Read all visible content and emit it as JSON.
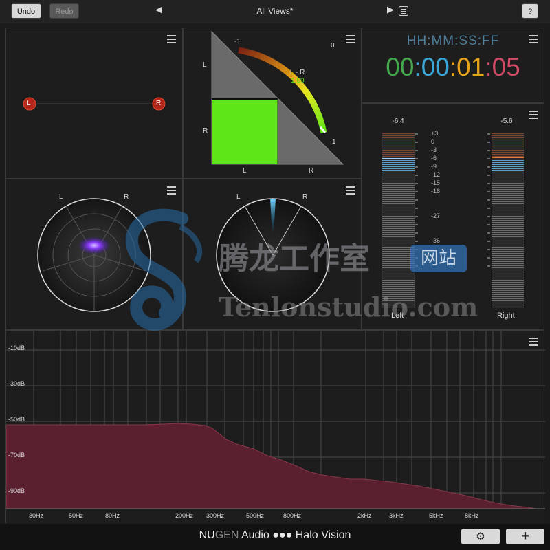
{
  "toolbar": {
    "undo": "Undo",
    "redo": "Redo",
    "prev_arrow": "◀",
    "view_name": "All Views*",
    "next_arrow": "▶",
    "help": "?"
  },
  "panels": {
    "stereo_position": {
      "left_label": "L",
      "right_label": "R"
    },
    "correlation": {
      "scale_minus1": "-1",
      "scale_0": "0",
      "scale_1": "1",
      "side_L_top": "L",
      "side_R_mid": "R",
      "bottom_L": "L",
      "bottom_R": "R",
      "readout_label": "L - R",
      "readout_value": "1.00",
      "correlation_value": 1.0
    },
    "timecode": {
      "format": "HH:MM:SS:FF",
      "hh": "00",
      "mm": "00",
      "ss": "01",
      "ff": "05",
      "sep": ":",
      "colors": {
        "hh": "#43a84b",
        "mm": "#3aa7d8",
        "ss": "#e6a21b",
        "ff": "#d04a66"
      }
    },
    "levels": {
      "left_peak": "-6.4",
      "right_peak": "-5.6",
      "left_label": "Left",
      "right_label": "Right",
      "scale": [
        "+3",
        "0",
        "-3",
        "-6",
        "-9",
        "-12",
        "-15",
        "-18",
        "-27",
        "-36"
      ]
    },
    "surround_left": {
      "left_label": "L",
      "right_label": "R"
    },
    "surround_right": {
      "left_label": "L",
      "right_label": "R"
    },
    "spectrum": {
      "y_labels": [
        "-10dB",
        "-30dB",
        "-50dB",
        "-70dB",
        "-90dB"
      ],
      "x_labels": [
        "30Hz",
        "50Hz",
        "80Hz",
        "200Hz",
        "300Hz",
        "500Hz",
        "800Hz",
        "2kHz",
        "3kHz",
        "5kHz",
        "8kHz"
      ]
    }
  },
  "footer": {
    "brand_nu": "NU",
    "brand_gen": "GEN",
    "brand_rest": " Audio ●●● Halo Vision",
    "settings_icon": "⚙",
    "add_icon": "+"
  },
  "watermark": {
    "chinese": "腾龙工作室",
    "site_badge": "网站",
    "url": "Tenlonstudio.com"
  },
  "colors": {
    "accent_green": "#5ee619",
    "spectrum_fill": "#5a2030",
    "panel_border": "#3a3a3a"
  }
}
